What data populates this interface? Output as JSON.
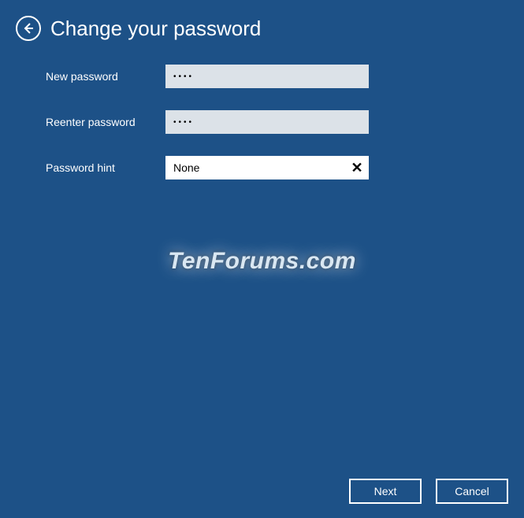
{
  "header": {
    "title": "Change your password"
  },
  "form": {
    "new_password": {
      "label": "New password",
      "value": "••••"
    },
    "reenter_password": {
      "label": "Reenter password",
      "value": "••••"
    },
    "password_hint": {
      "label": "Password hint",
      "value": "None"
    }
  },
  "watermark": "TenForums.com",
  "footer": {
    "next_label": "Next",
    "cancel_label": "Cancel"
  }
}
